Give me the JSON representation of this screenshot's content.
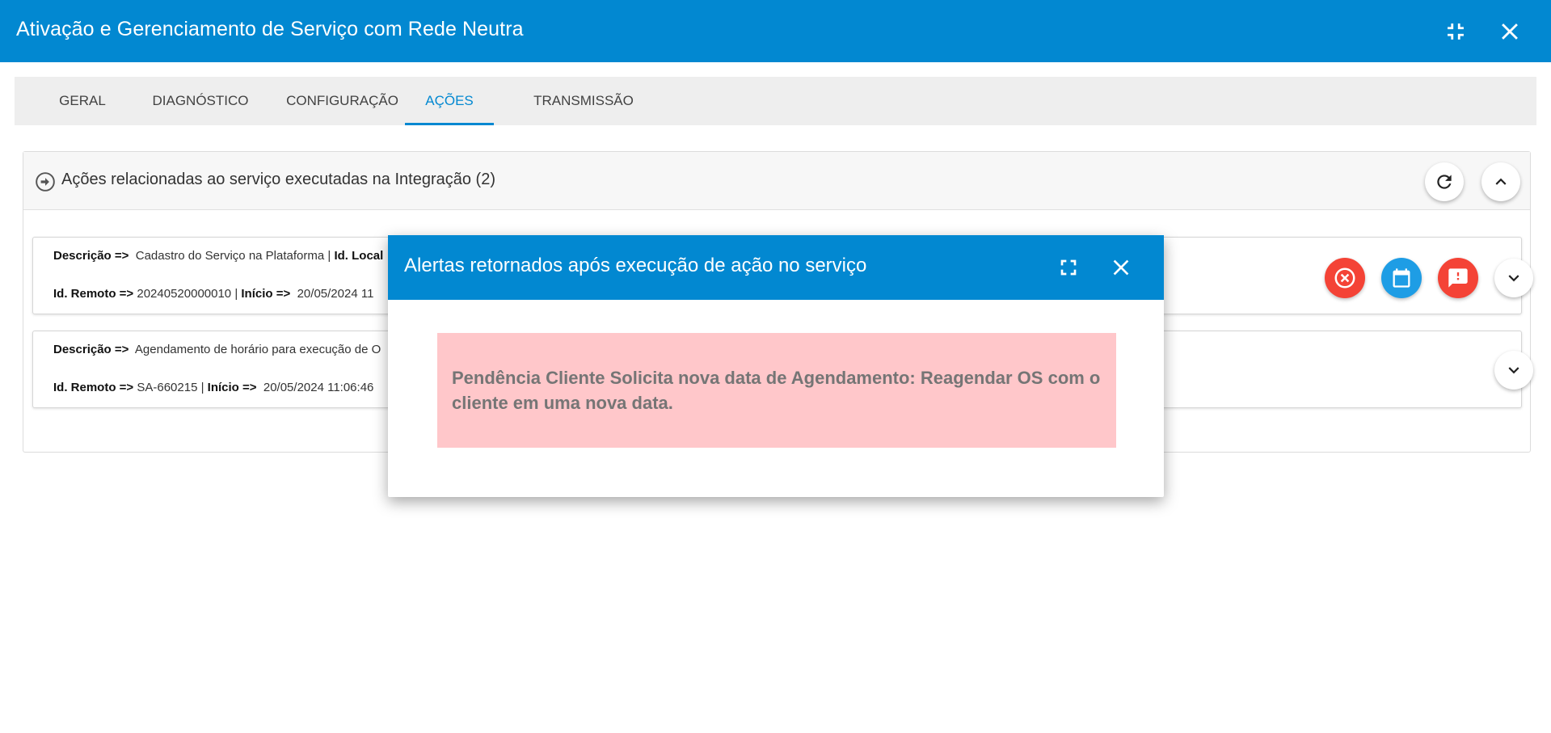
{
  "window": {
    "title": "Ativação e Gerenciamento de Serviço com Rede Neutra"
  },
  "tabs": [
    {
      "label": "GERAL"
    },
    {
      "label": "DIAGNÓSTICO"
    },
    {
      "label": "CONFIGURAÇÃO"
    },
    {
      "label": "AÇÕES",
      "active": true
    },
    {
      "label": "TRANSMISSÃO"
    }
  ],
  "panel": {
    "title": "Ações relacionadas ao serviço executadas na Integração (2)"
  },
  "cards": [
    {
      "descricao_label": "Descrição =>",
      "descricao_value": "Cadastro do Serviço na Plataforma |",
      "id_local_label": "Id. Local",
      "id_remoto_label": "Id. Remoto =>",
      "id_remoto_value": "20240520000010 |",
      "inicio_label": "Início =>",
      "inicio_value": "20/05/2024 11"
    },
    {
      "descricao_label": "Descrição =>",
      "descricao_value": "Agendamento de horário para execução de O",
      "id_remoto_label": "Id. Remoto =>",
      "id_remoto_value": "SA-660215 |",
      "inicio_label": "Início =>",
      "inicio_value": "20/05/2024 11:06:46"
    }
  ],
  "dialog": {
    "title": "Alertas retornados após execução de ação no serviço",
    "alert": "Pendência Cliente Solicita nova data de Agendamento: Reagendar OS com o cliente em uma nova data."
  },
  "colors": {
    "primary": "#0288d1",
    "danger": "#f44336",
    "info": "#1e9de5",
    "alert_bg": "#ffc7ca"
  },
  "icons": {
    "titlebar": [
      "compress-icon",
      "close-icon"
    ],
    "dialog": [
      "fullscreen-icon",
      "close-icon"
    ],
    "panel": [
      "arrow-circle-right-icon",
      "refresh-icon",
      "chevron-up-icon"
    ],
    "card_actions": [
      "cancel-circle-icon",
      "calendar-icon",
      "alert-message-icon",
      "chevron-down-icon"
    ]
  }
}
